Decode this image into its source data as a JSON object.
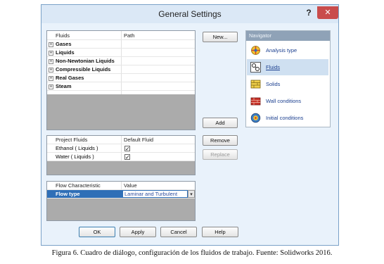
{
  "window": {
    "title": "General Settings",
    "help_label": "?",
    "close_label": "✕"
  },
  "fluids_table": {
    "headers": [
      "Fluids",
      "Path"
    ],
    "items": [
      {
        "label": "Gases"
      },
      {
        "label": "Liquids"
      },
      {
        "label": "Non-Newtonian Liquids"
      },
      {
        "label": "Compressible Liquids"
      },
      {
        "label": "Real Gases"
      },
      {
        "label": "Steam"
      }
    ]
  },
  "project_table": {
    "headers": [
      "Project Fluids",
      "Default Fluid"
    ],
    "rows": [
      {
        "name": "Ethanol ( Liquids )",
        "default": true
      },
      {
        "name": "Water ( Liquids )",
        "default": true
      }
    ]
  },
  "flow_table": {
    "headers": [
      "Flow Characteristic",
      "Value"
    ],
    "row": {
      "name": "Flow type",
      "value": "Laminar and Turbulent"
    }
  },
  "buttons": {
    "new": "New...",
    "add": "Add",
    "remove": "Remove",
    "replace": "Replace",
    "ok": "OK",
    "apply": "Apply",
    "cancel": "Cancel",
    "help": "Help"
  },
  "navigator": {
    "title": "Navigator",
    "items": [
      {
        "label": "Analysis type",
        "icon": "analysis-type-icon",
        "selected": false
      },
      {
        "label": "Fluids",
        "icon": "fluids-icon",
        "selected": true
      },
      {
        "label": "Solids",
        "icon": "solids-icon",
        "selected": false
      },
      {
        "label": "Wall conditions",
        "icon": "wall-conditions-icon",
        "selected": false
      },
      {
        "label": "Initial conditions",
        "icon": "initial-conditions-icon",
        "selected": false
      }
    ]
  },
  "caption": "Figura 6. Cuadro de diálogo, configuración de los fluidos de trabajo. Fuente: Solidworks 2016."
}
